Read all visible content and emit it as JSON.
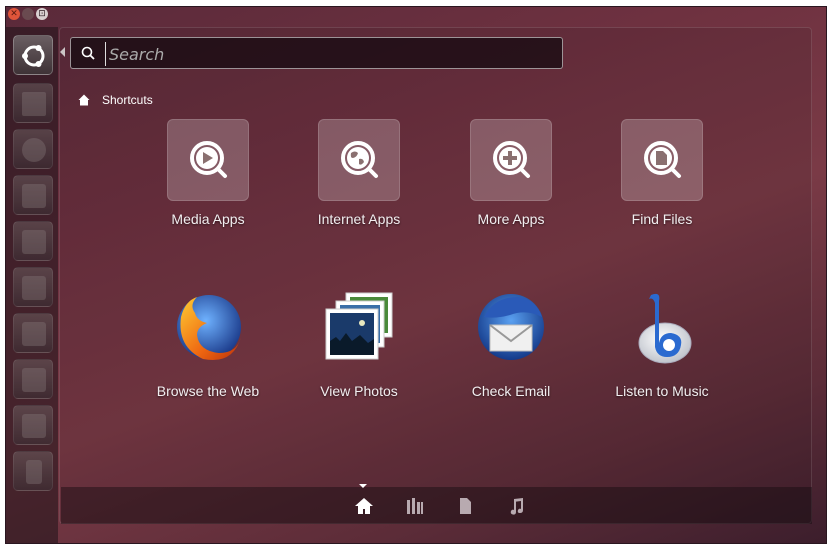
{
  "window": {
    "controls": [
      {
        "name": "close",
        "glyph": "✕"
      },
      {
        "name": "minimize",
        "glyph": ""
      },
      {
        "name": "maximize",
        "glyph": "⊡"
      }
    ]
  },
  "launcher": {
    "items": [
      {
        "icon": "ubuntu-dash-icon"
      },
      {
        "icon": "files-folder-icon"
      },
      {
        "icon": "web-browser-icon"
      },
      {
        "icon": "writer-document-icon"
      },
      {
        "icon": "calc-spreadsheet-icon"
      },
      {
        "icon": "impress-presentation-icon"
      },
      {
        "icon": "software-center-icon"
      },
      {
        "icon": "lock-icon"
      },
      {
        "icon": "workspace-switcher-icon"
      },
      {
        "icon": "trash-icon"
      }
    ]
  },
  "search": {
    "placeholder": "Search",
    "value": ""
  },
  "section": {
    "label": "Shortcuts"
  },
  "shortcuts": [
    {
      "label": "Media Apps",
      "icon": "media-apps-icon"
    },
    {
      "label": "Internet Apps",
      "icon": "internet-apps-icon"
    },
    {
      "label": "More Apps",
      "icon": "more-apps-icon"
    },
    {
      "label": "Find Files",
      "icon": "find-files-icon"
    },
    {
      "label": "Browse the Web",
      "icon": "firefox-icon"
    },
    {
      "label": "View Photos",
      "icon": "photos-icon"
    },
    {
      "label": "Check Email",
      "icon": "thunderbird-icon"
    },
    {
      "label": "Listen to Music",
      "icon": "banshee-icon"
    }
  ],
  "lenses": [
    {
      "name": "home",
      "active": true
    },
    {
      "name": "applications",
      "active": false
    },
    {
      "name": "files",
      "active": false
    },
    {
      "name": "music",
      "active": false
    }
  ]
}
